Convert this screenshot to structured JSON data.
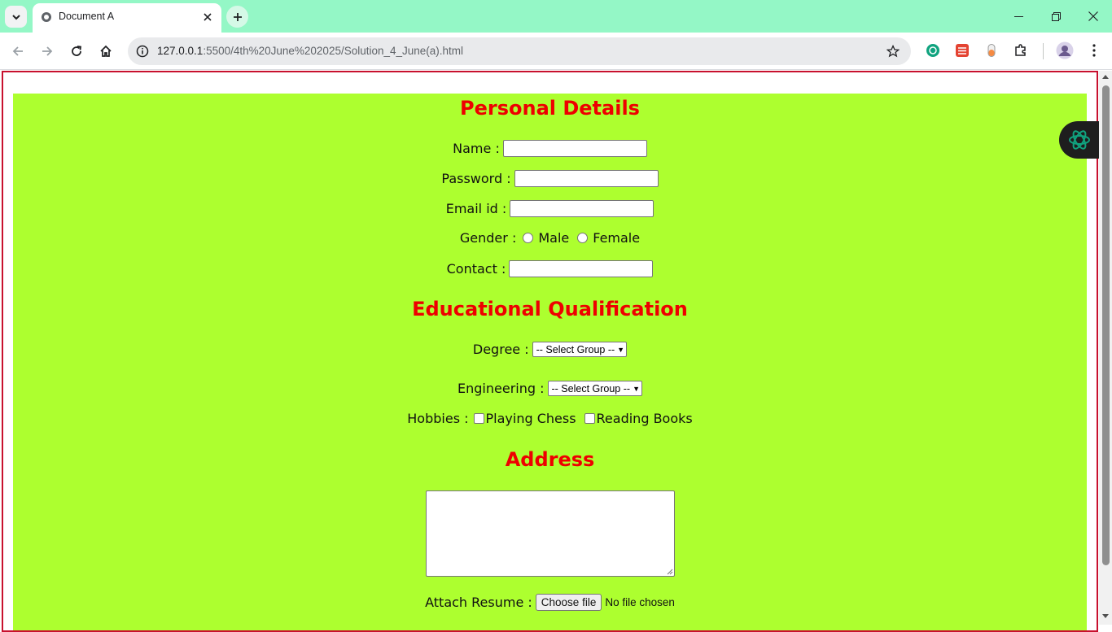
{
  "tab": {
    "title": "Document A"
  },
  "address_bar": {
    "host": "127.0.0.1",
    "path": ":5500/4th%20June%202025/Solution_4_June(a).html"
  },
  "sections": {
    "personal": "Personal Details",
    "education": "Educational Qualification",
    "address": "Address"
  },
  "fields": {
    "name_label": "Name :",
    "password_label": "Password :",
    "email_label": "Email id :",
    "gender_label": "Gender :",
    "gender_male": "Male",
    "gender_female": "Female",
    "contact_label": "Contact :",
    "degree_label": "Degree :",
    "degree_value": "-- Select Group --",
    "engineering_label": "Engineering :",
    "engineering_value": "-- Select Group --",
    "hobbies_label": "Hobbies :",
    "hobby_chess": "Playing Chess",
    "hobby_reading": "Reading Books",
    "resume_label": "Attach Resume :",
    "file_button": "Choose file",
    "file_status": "No file chosen"
  },
  "colors": {
    "page_bg": "#adff2f",
    "heading": "#ee0000",
    "frame": "#c8102e",
    "tabstrip": "#94f7c6"
  }
}
